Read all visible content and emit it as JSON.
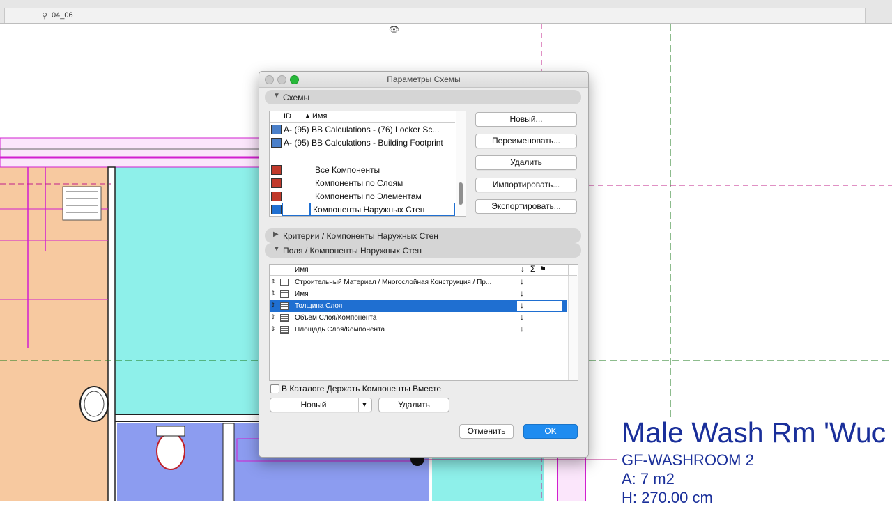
{
  "tabbar": {
    "view_name": "04_06"
  },
  "dialog": {
    "title": "Параметры Схемы",
    "schemes_section": "Схемы",
    "schemes_list": {
      "col_id": "ID",
      "col_name": "Имя",
      "items": [
        {
          "text": "A- (95) BB Calculations - (76) Locker Sc..."
        },
        {
          "text": "A- (95) BB Calculations - Building Footprint"
        },
        {
          "text": "Все Компоненты"
        },
        {
          "text": "Компоненты по Слоям"
        },
        {
          "text": "Компоненты по Элементам"
        },
        {
          "text": "Компоненты Наружных Стен"
        }
      ]
    },
    "buttons": {
      "new": "Новый...",
      "rename": "Переименовать...",
      "delete": "Удалить",
      "import": "Импортировать...",
      "export": "Экспортировать..."
    },
    "criteria_section": "Критерии /  Компоненты Наружных Стен",
    "fields_section": "Поля /  Компоненты Наружных Стен",
    "fields_table": {
      "col_name": "Имя",
      "col_sort": "↓",
      "col_sum": "Σ",
      "col_flag": "⚑",
      "rows": [
        {
          "name": "Строительный Материал / Многослойная Конструкция / Пр...",
          "sort": "↓",
          "selected": false
        },
        {
          "name": "Имя",
          "sort": "↓",
          "selected": false
        },
        {
          "name": "Толщина Слоя",
          "sort": "↓",
          "selected": true
        },
        {
          "name": "Объем Слоя/Компонента",
          "sort": "↓",
          "selected": false
        },
        {
          "name": "Площадь Слоя/Компонента",
          "sort": "↓",
          "selected": false
        }
      ]
    },
    "keep_together_label": "В Каталоге Держать Компоненты Вместе",
    "keep_together_checked": false,
    "add_field_label": "Новый",
    "delete_field_label": "Удалить",
    "cancel_label": "Отменить",
    "ok_label": "OK"
  },
  "room_label": {
    "title": "Male Wash Rm 'Wuc",
    "id": "GF-WASHROOM 2",
    "area": "A: 7 m2",
    "height": "H: 270.00 cm"
  },
  "colors": {
    "accent": "#1f6fd1",
    "room_orange": "#f7c9a0",
    "room_cyan": "#8ef0ea",
    "room_blue": "#8c9cf0",
    "wall_magenta": "#d21fd0",
    "room_text": "#1a2f9a"
  }
}
